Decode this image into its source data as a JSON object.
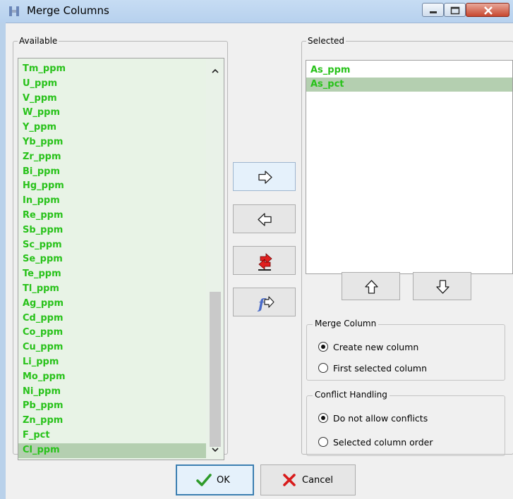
{
  "window": {
    "title": "Merge Columns"
  },
  "available": {
    "legend": "Available",
    "items": [
      "Tm_ppm",
      "U_ppm",
      "V_ppm",
      "W_ppm",
      "Y_ppm",
      "Yb_ppm",
      "Zr_ppm",
      "Bi_ppm",
      "Hg_ppm",
      "In_ppm",
      "Re_ppm",
      "Sb_ppm",
      "Sc_ppm",
      "Se_ppm",
      "Te_ppm",
      "Tl_ppm",
      "Ag_ppm",
      "Cd_ppm",
      "Co_ppm",
      "Cu_ppm",
      "Li_ppm",
      "Mo_ppm",
      "Ni_ppm",
      "Pb_ppm",
      "Zn_ppm",
      "F_pct",
      "Cl_ppm"
    ],
    "selected_index": 26
  },
  "selected": {
    "legend": "Selected",
    "items": [
      "As_ppm",
      "As_pct"
    ],
    "selected_index": 1
  },
  "merge_column": {
    "caption": "Merge Column",
    "options": [
      "Create new column",
      "First selected column"
    ],
    "checked_index": 0
  },
  "conflict_handling": {
    "caption": "Conflict Handling",
    "options": [
      "Do not allow conflicts",
      "Selected column order"
    ],
    "checked_index": 0
  },
  "buttons": {
    "ok": "OK",
    "cancel": "Cancel"
  },
  "icons": {
    "add": "arrow-right-icon",
    "remove": "arrow-left-icon",
    "remove_all": "remove-all-icon",
    "formula": "formula-arrow-icon",
    "move_up": "arrow-up-icon",
    "move_down": "arrow-down-icon"
  },
  "colors": {
    "item_text": "#28c21a",
    "available_bg": "#e8f3e6",
    "item_selected_bg": "#b4cfb0"
  }
}
